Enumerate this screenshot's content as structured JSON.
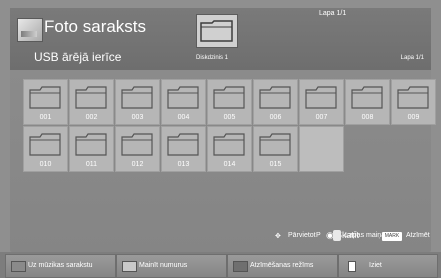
{
  "app": {
    "title": "Foto saraksts",
    "page_top": "Lapa 1/1"
  },
  "drive": {
    "label": "Diskdzinis 1"
  },
  "location": {
    "label": "USB ārējā ierīce",
    "page": "Lapa 1/1"
  },
  "folders": [
    "001",
    "002",
    "003",
    "004",
    "005",
    "006",
    "007",
    "008",
    "009",
    "010",
    "011",
    "012",
    "013",
    "014",
    "015"
  ],
  "help": {
    "move": "Pārvietot",
    "view": "Skatīt",
    "p": "P",
    "pages": "Lapas maiņa",
    "mark_key": "MARK",
    "mark": "Atzīmēt"
  },
  "buttons": [
    {
      "label": "Uz mūzikas sarakstu",
      "color": "#8a8a8a"
    },
    {
      "label": "Mainīt numurus",
      "color": "#c9c9c9"
    },
    {
      "label": "Atzīmēšanas režīms",
      "color": "#6f6f6f"
    },
    {
      "label": "Iziet",
      "color": "#ffffff"
    }
  ]
}
